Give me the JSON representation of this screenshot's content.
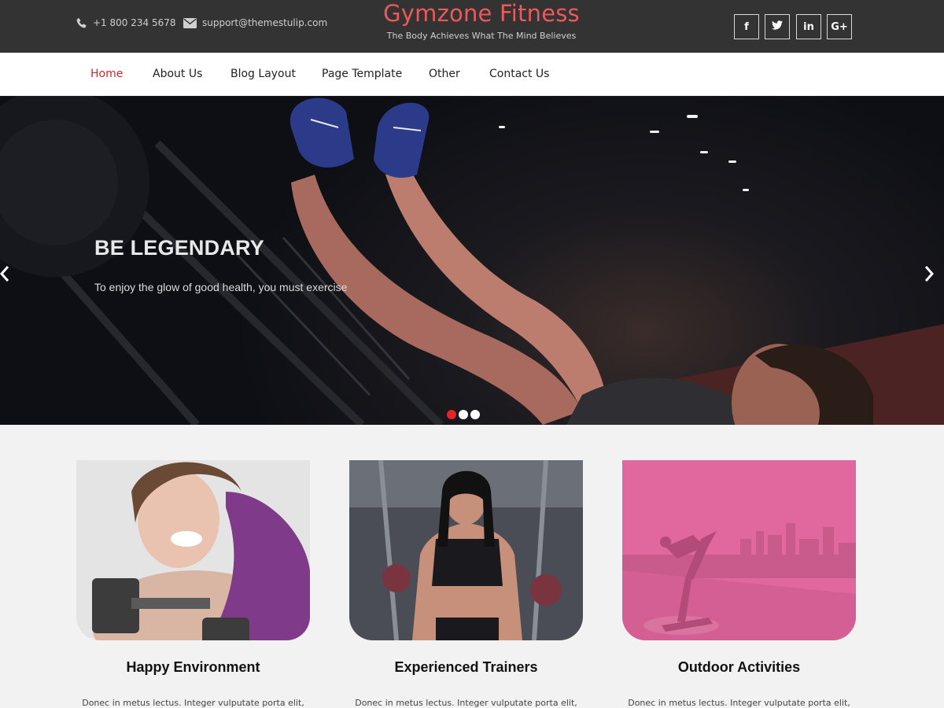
{
  "topbar": {
    "phone": "+1 800 234 5678",
    "email": "support@themestulip.com",
    "brand_title": "Gymzone Fitness",
    "brand_tagline": "The Body Achieves What The Mind Believes",
    "social": [
      {
        "name": "facebook-icon",
        "glyph": "f"
      },
      {
        "name": "twitter-icon",
        "glyph": "t"
      },
      {
        "name": "linkedin-icon",
        "glyph": "in"
      },
      {
        "name": "google-plus-icon",
        "glyph": "G+"
      }
    ]
  },
  "nav": {
    "items": [
      {
        "label": "Home",
        "active": true
      },
      {
        "label": "About Us"
      },
      {
        "label": "Blog Layout"
      },
      {
        "label": "Page Template"
      },
      {
        "label": "Other"
      },
      {
        "label": "Contact Us"
      }
    ]
  },
  "hero": {
    "heading": "BE LEGENDARY",
    "text": "To enjoy the glow of good health, you must exercise",
    "slides": 3,
    "active_slide": 1
  },
  "features": [
    {
      "title": "Happy Environment",
      "text": "Donec in metus lectus. Integer vulputate porta elit,"
    },
    {
      "title": "Experienced Trainers",
      "text": "Donec in metus lectus. Integer vulputate porta elit,"
    },
    {
      "title": "Outdoor Activities",
      "text": "Donec in metus lectus. Integer vulputate porta elit,"
    }
  ],
  "colors": {
    "accent": "#ea5a5a",
    "nav_active": "#d3242a",
    "topbar_bg": "#333333",
    "page_bg": "#f2f2f2",
    "overlay_pink": "#e0689e"
  }
}
